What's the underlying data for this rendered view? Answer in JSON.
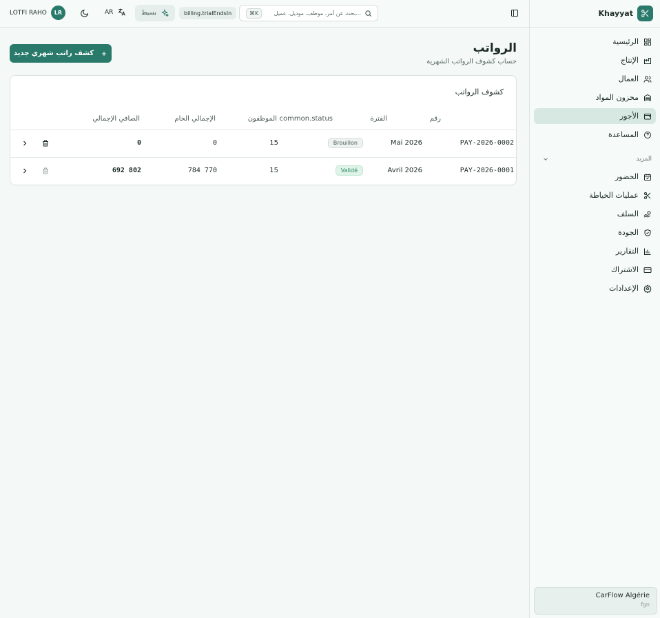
{
  "colors": {
    "accent": "#2a7a6b",
    "active_bg": "#d7e8e2",
    "validated": "#2e8b5e"
  },
  "sidebar": {
    "brand": "Khayyat",
    "items": [
      {
        "label": "الرئيسية",
        "icon": "dashboard-icon"
      },
      {
        "label": "الإنتاج",
        "icon": "factory-icon"
      },
      {
        "label": "العمال",
        "icon": "users-icon"
      },
      {
        "label": "مخزون المواد",
        "icon": "warehouse-icon"
      },
      {
        "label": "الأجور",
        "icon": "wallet-icon"
      },
      {
        "label": "المساعدة",
        "icon": "help-icon"
      }
    ],
    "more_label": "المزيد",
    "more_items": [
      {
        "label": "الحضور",
        "icon": "calendar-check-icon"
      },
      {
        "label": "عمليات الخياطة",
        "icon": "scissors-icon"
      },
      {
        "label": "السلف",
        "icon": "hand-coins-icon"
      },
      {
        "label": "الجودة",
        "icon": "shield-check-icon"
      },
      {
        "label": "التقارير",
        "icon": "bar-chart-icon"
      },
      {
        "label": "الاشتراك",
        "icon": "credit-card-icon"
      },
      {
        "label": "الإعدادات",
        "icon": "gear-icon"
      }
    ],
    "org": {
      "name": "CarFlow Algérie",
      "sub": "fgn"
    }
  },
  "topbar": {
    "user_name": "LOTFI RAHO",
    "user_initials": "LR",
    "lang": "AR",
    "plan": "بسيط",
    "trial": "billing.trialEndsIn",
    "search_placeholder": "بحث عن أمر، موظف، موديل، عميل...",
    "search_kbd": "⌘K"
  },
  "page": {
    "title": "الرواتب",
    "subtitle": "حساب كشوف الرواتب الشهرية",
    "new_button": "كشف راتب شهري جديد"
  },
  "table": {
    "title": "كشوف الرواتب",
    "headers": {
      "number": "رقم",
      "period": "الفترة",
      "status": "common.status",
      "employees": "الموظفون",
      "gross": "الإجمالي الخام",
      "net": "الصافي الإجمالي"
    },
    "rows": [
      {
        "number": "PAY-2026-0002",
        "period": "Mai 2026",
        "status": "Brouillon",
        "employees": "15",
        "gross": "0",
        "net": "0"
      },
      {
        "number": "PAY-2026-0001",
        "period": "Avril 2026",
        "status": "Validé",
        "employees": "15",
        "gross": "784 770",
        "net": "692 802"
      }
    ]
  }
}
